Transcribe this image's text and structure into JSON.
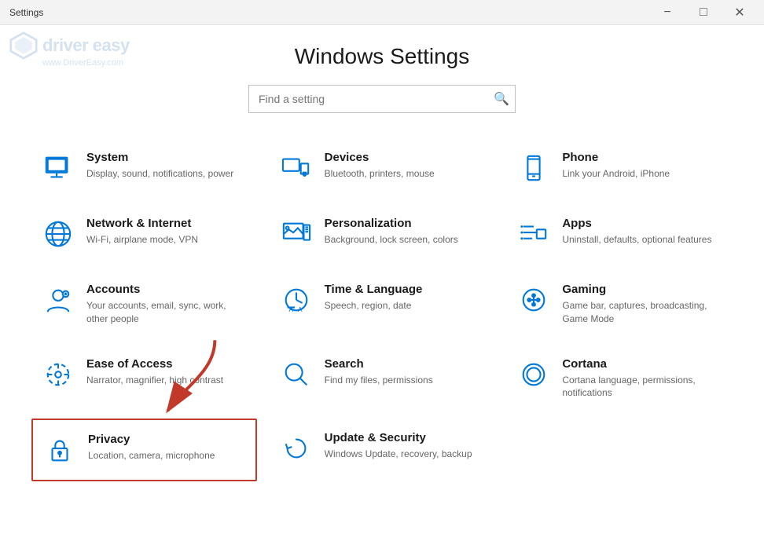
{
  "titlebar": {
    "title": "Settings",
    "minimize_label": "−",
    "maximize_label": "□",
    "close_label": "✕"
  },
  "watermark": {
    "brand": "driver easy",
    "url": "www.DriverEasy.com"
  },
  "page": {
    "title": "Windows Settings",
    "search_placeholder": "Find a setting"
  },
  "settings": [
    {
      "id": "system",
      "name": "System",
      "desc": "Display, sound, notifications, power",
      "icon": "system"
    },
    {
      "id": "devices",
      "name": "Devices",
      "desc": "Bluetooth, printers, mouse",
      "icon": "devices"
    },
    {
      "id": "phone",
      "name": "Phone",
      "desc": "Link your Android, iPhone",
      "icon": "phone"
    },
    {
      "id": "network",
      "name": "Network & Internet",
      "desc": "Wi-Fi, airplane mode, VPN",
      "icon": "network"
    },
    {
      "id": "personalization",
      "name": "Personalization",
      "desc": "Background, lock screen, colors",
      "icon": "personalization"
    },
    {
      "id": "apps",
      "name": "Apps",
      "desc": "Uninstall, defaults, optional features",
      "icon": "apps"
    },
    {
      "id": "accounts",
      "name": "Accounts",
      "desc": "Your accounts, email, sync, work, other people",
      "icon": "accounts"
    },
    {
      "id": "time",
      "name": "Time & Language",
      "desc": "Speech, region, date",
      "icon": "time"
    },
    {
      "id": "gaming",
      "name": "Gaming",
      "desc": "Game bar, captures, broadcasting, Game Mode",
      "icon": "gaming"
    },
    {
      "id": "ease",
      "name": "Ease of Access",
      "desc": "Narrator, magnifier, high contrast",
      "icon": "ease"
    },
    {
      "id": "search",
      "name": "Search",
      "desc": "Find my files, permissions",
      "icon": "search"
    },
    {
      "id": "cortana",
      "name": "Cortana",
      "desc": "Cortana language, permissions, notifications",
      "icon": "cortana"
    },
    {
      "id": "privacy",
      "name": "Privacy",
      "desc": "Location, camera, microphone",
      "icon": "privacy",
      "highlighted": true
    },
    {
      "id": "update",
      "name": "Update & Security",
      "desc": "Windows Update, recovery, backup",
      "icon": "update"
    }
  ],
  "colors": {
    "accent": "#0078d7",
    "highlight_border": "#c0392b",
    "arrow": "#c0392b"
  }
}
